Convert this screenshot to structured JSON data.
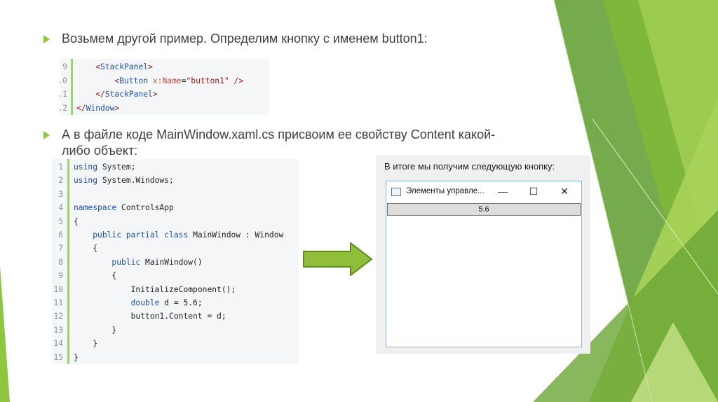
{
  "colors": {
    "accent": "#8dc63f",
    "arrow": "#8fbf3a",
    "arrow_border": "#5f8a1e"
  },
  "bullets": [
    {
      "line1": "Возьмем другой пример. Определим кнопку с именем button1:"
    },
    {
      "line1": "А в файле коде MainWindow.xaml.cs присвоим ее свойству Content какой-",
      "line2": "либо объект:"
    }
  ],
  "xaml_snippet": {
    "line_numbers": [
      "9",
      ".0",
      ".1",
      ".2"
    ],
    "lines": [
      {
        "indent": "    ",
        "parts": [
          [
            "tag",
            "<"
          ],
          [
            "tname",
            "StackPanel"
          ],
          [
            "tag",
            ">"
          ]
        ]
      },
      {
        "indent": "        ",
        "parts": [
          [
            "tag",
            "<"
          ],
          [
            "tname",
            "Button"
          ],
          [
            "plain",
            " "
          ],
          [
            "ns",
            "x"
          ],
          [
            "attr",
            ":Name"
          ],
          [
            "plain",
            "="
          ],
          [
            "str",
            "\"button1\""
          ],
          [
            "plain",
            " "
          ],
          [
            "tag",
            "/>"
          ]
        ]
      },
      {
        "indent": "    ",
        "parts": [
          [
            "tag",
            "</"
          ],
          [
            "tname",
            "StackPanel"
          ],
          [
            "tag",
            ">"
          ]
        ]
      },
      {
        "indent": "",
        "parts": [
          [
            "tag",
            "</"
          ],
          [
            "tname",
            "Window"
          ],
          [
            "tag",
            ">"
          ]
        ]
      }
    ]
  },
  "cs_snippet": {
    "line_numbers": [
      "1",
      "2",
      "3",
      "4",
      "5",
      "6",
      "7",
      "8",
      "9",
      "10",
      "11",
      "12",
      "13",
      "14",
      "15"
    ],
    "lines": [
      {
        "indent": "",
        "parts": [
          [
            "kw",
            "using"
          ],
          [
            "plain",
            " System;"
          ]
        ]
      },
      {
        "indent": "",
        "parts": [
          [
            "kw",
            "using"
          ],
          [
            "plain",
            " System.Windows;"
          ]
        ]
      },
      {
        "indent": "",
        "parts": []
      },
      {
        "indent": "",
        "parts": [
          [
            "kw",
            "namespace"
          ],
          [
            "plain",
            " ControlsApp"
          ]
        ]
      },
      {
        "indent": "",
        "parts": [
          [
            "plain",
            "{"
          ]
        ]
      },
      {
        "indent": "    ",
        "parts": [
          [
            "kw",
            "public"
          ],
          [
            "plain",
            " "
          ],
          [
            "kw",
            "partial"
          ],
          [
            "plain",
            " "
          ],
          [
            "kw",
            "class"
          ],
          [
            "plain",
            " MainWindow : Window"
          ]
        ]
      },
      {
        "indent": "    ",
        "parts": [
          [
            "plain",
            "{"
          ]
        ]
      },
      {
        "indent": "        ",
        "parts": [
          [
            "kw",
            "public"
          ],
          [
            "plain",
            " MainWindow()"
          ]
        ]
      },
      {
        "indent": "        ",
        "parts": [
          [
            "plain",
            "{"
          ]
        ]
      },
      {
        "indent": "            ",
        "parts": [
          [
            "plain",
            "InitializeComponent();"
          ]
        ]
      },
      {
        "indent": "            ",
        "parts": [
          [
            "kw",
            "double"
          ],
          [
            "plain",
            " d = 5.6;"
          ]
        ]
      },
      {
        "indent": "            ",
        "parts": [
          [
            "plain",
            "button1.Content = d;"
          ]
        ]
      },
      {
        "indent": "        ",
        "parts": [
          [
            "plain",
            "}"
          ]
        ]
      },
      {
        "indent": "    ",
        "parts": [
          [
            "plain",
            "}"
          ]
        ]
      },
      {
        "indent": "",
        "parts": [
          [
            "plain",
            "}"
          ]
        ]
      }
    ]
  },
  "result": {
    "caption": "В итоге мы получим следующую кнопку:",
    "window": {
      "title": "Элементы управле...",
      "minimize_glyph": "—",
      "maximize_glyph": "☐",
      "close_glyph": "✕",
      "button_content": "5.6"
    }
  }
}
